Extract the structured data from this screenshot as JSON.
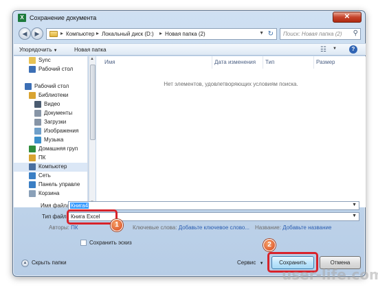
{
  "window": {
    "title": "Сохранение документа",
    "app_icon_letter": "X",
    "close_symbol": "✕"
  },
  "address_bar": {
    "crumbs": [
      "Компьютер",
      "Локальный диск (D:)",
      "Новая папка (2)"
    ],
    "search_placeholder": "Поиск: Новая папка (2)"
  },
  "toolbar": {
    "organize_label": "Упорядочить",
    "new_folder_label": "Новая папка"
  },
  "nav_pane": {
    "items": [
      {
        "label": "Sync",
        "icon": "folder-icon",
        "color": "#e8c252"
      },
      {
        "label": "Рабочий стол",
        "icon": "desktop-icon",
        "color": "#3c6fb5"
      },
      {
        "label": "Рабочий стол",
        "icon": "desktop-icon",
        "color": "#3c6fb5"
      },
      {
        "label": "Библиотеки",
        "icon": "library-icon",
        "color": "#d9a431"
      },
      {
        "label": "Видео",
        "icon": "video-icon",
        "color": "#4a5b70"
      },
      {
        "label": "Документы",
        "icon": "documents-icon",
        "color": "#8795a6"
      },
      {
        "label": "Загрузки",
        "icon": "downloads-icon",
        "color": "#8795a6"
      },
      {
        "label": "Изображения",
        "icon": "images-icon",
        "color": "#6f9fc9"
      },
      {
        "label": "Музыка",
        "icon": "music-icon",
        "color": "#3a8ec9"
      },
      {
        "label": "Домашняя груп",
        "icon": "homegroup-icon",
        "color": "#2f8d3c"
      },
      {
        "label": "ПК",
        "icon": "pc-icon",
        "color": "#d9a431"
      },
      {
        "label": "Компьютер",
        "icon": "computer-icon",
        "color": "#4a6fa0"
      },
      {
        "label": "Сеть",
        "icon": "network-icon",
        "color": "#3b7fc4"
      },
      {
        "label": "Панель управле",
        "icon": "control-panel-icon",
        "color": "#3b7fc4"
      },
      {
        "label": "Корзина",
        "icon": "recycle-bin-icon",
        "color": "#8aa0b8"
      }
    ]
  },
  "file_list": {
    "columns": [
      "Имя",
      "Дата изменения",
      "Тип",
      "Размер"
    ],
    "empty_message": "Нет элементов, удовлетворяющих условиям поиска."
  },
  "form": {
    "filename_label": "Имя файла:",
    "filename_value": "Книга4",
    "filetype_label": "Тип файла:",
    "filetype_value": "Книга Excel",
    "authors_label": "Авторы:",
    "authors_value": "ПК",
    "keywords_label": "Ключевые слова:",
    "keywords_value": "Добавьте ключевое слово...",
    "title_label": "Название:",
    "title_value": "Добавьте название",
    "thumbnail_label": "Сохранить эскиз"
  },
  "footer": {
    "hide_folders_label": "Скрыть папки",
    "service_label": "Сервис",
    "save_label": "Сохранить",
    "cancel_label": "Отмена"
  },
  "annotations": {
    "badge_1": "1",
    "badge_2": "2",
    "highlight_color": "#d8222a"
  },
  "watermark": "user-life.com"
}
